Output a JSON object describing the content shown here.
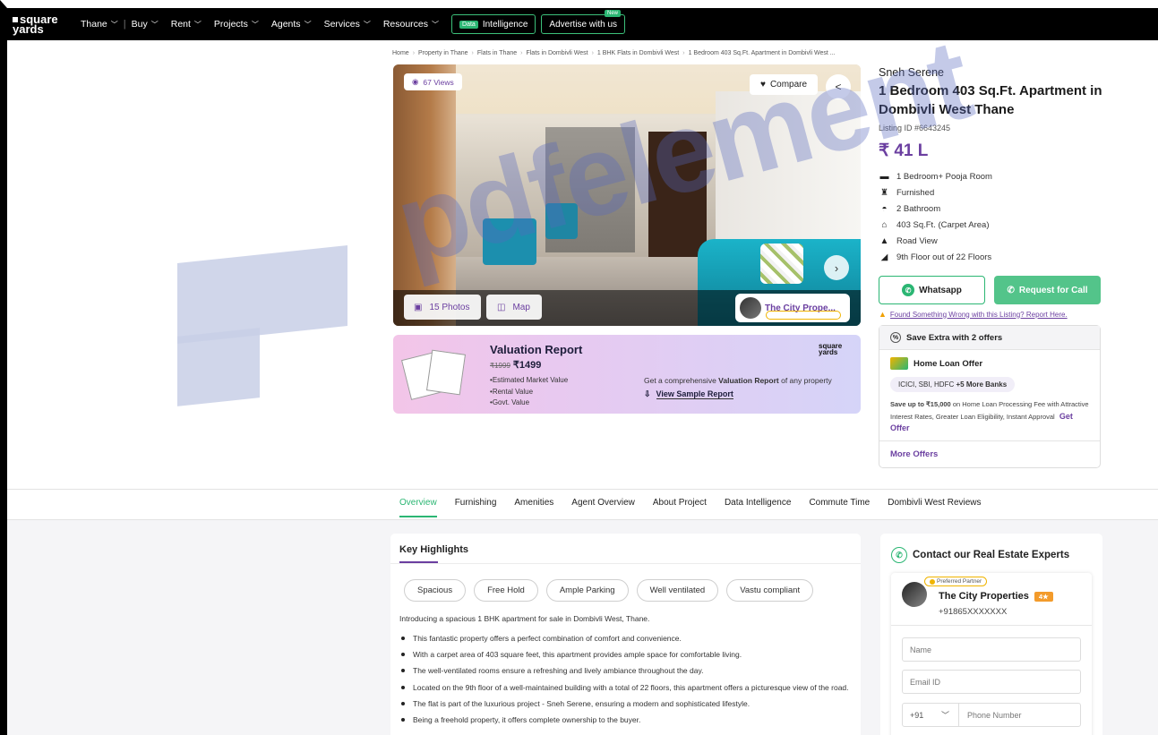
{
  "nav": {
    "logo_line1": "square",
    "logo_line2": "yards",
    "items": [
      {
        "label": "Thane"
      },
      {
        "label": "Buy"
      },
      {
        "label": "Rent"
      },
      {
        "label": "Projects"
      },
      {
        "label": "Agents"
      },
      {
        "label": "Services"
      },
      {
        "label": "Resources"
      }
    ],
    "intelligence": {
      "tag": "Data",
      "label": "Intelligence"
    },
    "advertise": {
      "label": "Advertise with us",
      "badge": "New"
    }
  },
  "breadcrumb": [
    "Home",
    "Property in Thane",
    "Flats in Thane",
    "Flats in Dombivli West",
    "1 BHK Flats in Dombivli West",
    "1 Bedroom 403 Sq.Ft. Apartment in Dombivli West ..."
  ],
  "gallery": {
    "views": "67 Views",
    "compare": "Compare",
    "photos": "15 Photos",
    "map": "Map",
    "agent_name": "The City Prope..."
  },
  "valuation": {
    "title": "Valuation Report",
    "old_price": "₹1999",
    "price": "₹1499",
    "items": [
      "Estimated Market Value",
      "Rental Value",
      "Govt. Value"
    ],
    "desc_pre": "Get a comprehensive",
    "desc_bold": "Valuation Report",
    "desc_post": "of any property",
    "sample": "View Sample Report",
    "logo_line1": "square",
    "logo_line2": "yards"
  },
  "listing": {
    "project": "Sneh Serene",
    "title": "1 Bedroom 403 Sq.Ft. Apartment in Dombivli West Thane",
    "listing_id": "Listing ID #6643245",
    "price": "₹ 41 L",
    "features": [
      {
        "icon": "bed-icon",
        "text": "1 Bedroom+ Pooja Room"
      },
      {
        "icon": "sofa-icon",
        "text": "Furnished"
      },
      {
        "icon": "bathtub-icon",
        "text": "2 Bathroom"
      },
      {
        "icon": "home-icon",
        "text": "403 Sq.Ft. (Carpet Area)"
      },
      {
        "icon": "road-icon",
        "text": "Road View"
      },
      {
        "icon": "stairs-icon",
        "text": "9th Floor out of 22 Floors"
      }
    ],
    "whatsapp": "Whatsapp",
    "request_call": "Request for Call",
    "report": "Found Something Wrong with this Listing? Report Here."
  },
  "offers": {
    "head": "Save Extra with 2 offers",
    "home_loan_title": "Home Loan Offer",
    "banks": "ICICI, SBI, HDFC",
    "banks_more": "+5 More Banks",
    "desc_bold": "Save up to ₹15,000",
    "desc": "on Home Loan Processing Fee with Attractive Interest Rates, Greater Loan Eligibility, Instant Approval",
    "get_offer": "Get Offer",
    "more": "More Offers"
  },
  "tabs": [
    "Overview",
    "Furnishing",
    "Amenities",
    "Agent Overview",
    "About Project",
    "Data Intelligence",
    "Commute Time",
    "Dombivli West Reviews"
  ],
  "highlights": {
    "title": "Key Highlights",
    "pills": [
      "Spacious",
      "Free Hold",
      "Ample Parking",
      "Well ventilated",
      "Vastu compliant"
    ],
    "intro": "Introducing a spacious 1 BHK apartment for sale in Dombivli West, Thane.",
    "points": [
      "This fantastic property offers a perfect combination of comfort and convenience.",
      "With a carpet area of 403 square feet, this apartment provides ample space for comfortable living.",
      "The well-ventilated rooms ensure a refreshing and lively ambiance throughout the day.",
      "Located on the 9th floor of a well-maintained building with a total of 22 floors, this apartment offers a picturesque view of the road.",
      "The flat is part of the luxurious project - Sneh Serene, ensuring a modern and sophisticated lifestyle.",
      "Being a freehold property, it offers complete ownership to the buyer."
    ]
  },
  "contact": {
    "head": "Contact our Real Estate Experts",
    "preferred": "Preferred Partner",
    "agent": "The City Properties",
    "rating": "4★",
    "phone": "+91865XXXXXXX",
    "name_ph": "Name",
    "email_ph": "Email ID",
    "country_code": "+91",
    "phone_ph": "Phone Number"
  },
  "watermark": "pdfelement",
  "colors": {
    "accent": "#6b3fa0",
    "green": "#2bb673"
  }
}
